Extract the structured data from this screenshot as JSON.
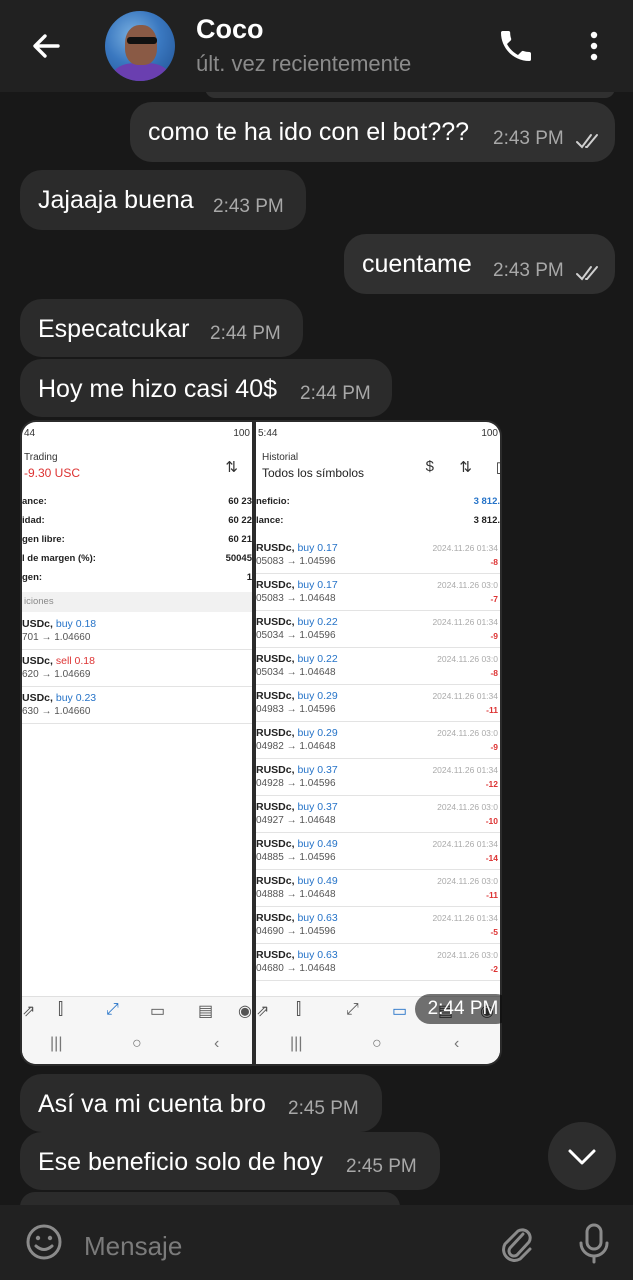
{
  "header": {
    "contact_name": "Coco",
    "contact_status": "últ. vez recientemente",
    "back_icon": "arrow-back-icon",
    "call_icon": "phone-icon",
    "menu_icon": "more-vert-icon"
  },
  "messages": [
    {
      "dir": "out",
      "text": "como te ha ido con el bot???",
      "time": "2:43 PM",
      "read": true
    },
    {
      "dir": "in",
      "text": "Jajaaja buena",
      "time": "2:43 PM"
    },
    {
      "dir": "out",
      "text": "cuentame",
      "time": "2:43 PM",
      "read": true
    },
    {
      "dir": "in",
      "text": "Especatcukar",
      "time": "2:44 PM"
    },
    {
      "dir": "in",
      "text": "Hoy me hizo casi 40$",
      "time": "2:44 PM"
    },
    {
      "dir": "in",
      "type": "image",
      "time": "2:44 PM"
    },
    {
      "dir": "in",
      "text": "Así va mi cuenta bro",
      "time": "2:45 PM"
    },
    {
      "dir": "in",
      "text": "Ese beneficio solo de hoy",
      "time": "2:45 PM"
    }
  ],
  "screenshot": {
    "left": {
      "status_time": "44",
      "status_right": "100",
      "title": "Trading",
      "subtitle": "-9.30 USC",
      "rows": [
        {
          "k": "ance:",
          "v": "60 23"
        },
        {
          "k": "idad:",
          "v": "60 22"
        },
        {
          "k": "gen libre:",
          "v": "60 21"
        },
        {
          "k": "l de margen (%):",
          "v": "50045"
        },
        {
          "k": "gen:",
          "v": "1"
        }
      ],
      "section": "iciones",
      "positions": [
        {
          "sym": "USDc,",
          "side": "buy 0.18",
          "side_color": "blue",
          "prices": "701 → 1.04660"
        },
        {
          "sym": "USDc,",
          "side": "sell 0.18",
          "side_color": "red",
          "prices": "620 → 1.04669"
        },
        {
          "sym": "USDc,",
          "side": "buy 0.23",
          "side_color": "blue",
          "prices": "630 → 1.04660"
        }
      ]
    },
    "right": {
      "status_time": "5:44",
      "status_right": "100",
      "title": "Historial",
      "subtitle": "Todos los símbolos",
      "rows": [
        {
          "k": "neficio:",
          "v": "3 812."
        },
        {
          "k": "lance:",
          "v": "3 812."
        }
      ],
      "positions": [
        {
          "sym": "RUSDc,",
          "side": "buy 0.17",
          "prices": "05083 → 1.04596",
          "date": "2024.11.26 01:34",
          "pl": "-8"
        },
        {
          "sym": "RUSDc,",
          "side": "buy 0.17",
          "prices": "05083 → 1.04648",
          "date": "2024.11.26 03:0",
          "pl": "-7"
        },
        {
          "sym": "RUSDc,",
          "side": "buy 0.22",
          "prices": "05034 → 1.04596",
          "date": "2024.11.26 01:34",
          "pl": "-9"
        },
        {
          "sym": "RUSDc,",
          "side": "buy 0.22",
          "prices": "05034 → 1.04648",
          "date": "2024.11.26 03:0",
          "pl": "-8"
        },
        {
          "sym": "RUSDc,",
          "side": "buy 0.29",
          "prices": "04983 → 1.04596",
          "date": "2024.11.26 01:34",
          "pl": "-11"
        },
        {
          "sym": "RUSDc,",
          "side": "buy 0.29",
          "prices": "04982 → 1.04648",
          "date": "2024.11.26 03:0",
          "pl": "-9"
        },
        {
          "sym": "RUSDc,",
          "side": "buy 0.37",
          "prices": "04928 → 1.04596",
          "date": "2024.11.26 01:34",
          "pl": "-12"
        },
        {
          "sym": "RUSDc,",
          "side": "buy 0.37",
          "prices": "04927 → 1.04648",
          "date": "2024.11.26 03:0",
          "pl": "-10"
        },
        {
          "sym": "RUSDc,",
          "side": "buy 0.49",
          "prices": "04885 → 1.04596",
          "date": "2024.11.26 01:34",
          "pl": "-14"
        },
        {
          "sym": "RUSDc,",
          "side": "buy 0.49",
          "prices": "04888 → 1.04648",
          "date": "2024.11.26 03:0",
          "pl": "-11"
        },
        {
          "sym": "RUSDc,",
          "side": "buy 0.63",
          "prices": "04690 → 1.04596",
          "date": "2024.11.26 01:34",
          "pl": "-5"
        },
        {
          "sym": "RUSDc,",
          "side": "buy 0.63",
          "prices": "04680 → 1.04648",
          "date": "2024.11.26 03:0",
          "pl": "-2"
        }
      ]
    }
  },
  "input": {
    "placeholder": "Mensaje",
    "emoji_icon": "emoji-icon",
    "attach_icon": "paperclip-icon",
    "mic_icon": "microphone-icon"
  },
  "colors": {
    "background": "#181818",
    "bar": "#212121",
    "bubble": "#2b2b2b",
    "time": "#a8a8a8",
    "placeholder": "#7b7b7b"
  }
}
